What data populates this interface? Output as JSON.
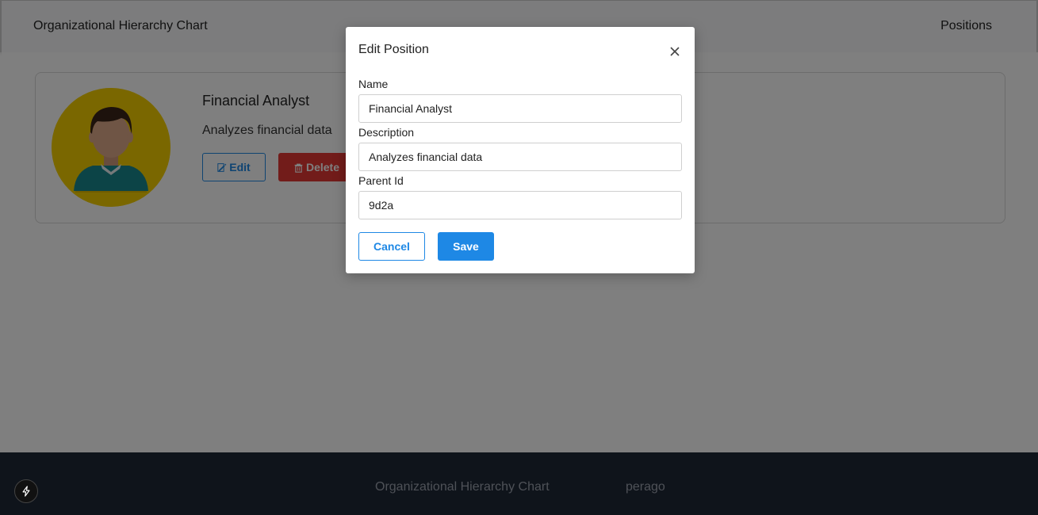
{
  "navbar": {
    "title": "Organizational Hierarchy Chart",
    "link": "Positions"
  },
  "card": {
    "title": "Financial Analyst",
    "description": "Analyzes financial data",
    "edit_label": "Edit",
    "delete_label": "Delete",
    "avatar_bg": "#f5cf00"
  },
  "modal": {
    "title": "Edit Position",
    "fields": [
      {
        "label": "Name",
        "value": "Financial Analyst"
      },
      {
        "label": "Description",
        "value": "Analyzes financial data"
      },
      {
        "label": "Parent Id",
        "value": "9d2a"
      }
    ],
    "cancel_label": "Cancel",
    "save_label": "Save"
  },
  "footer": {
    "title": "Organizational Hierarchy Chart",
    "brand": "perago"
  },
  "colors": {
    "accent": "#1e88e5",
    "danger": "#e53935",
    "footer_bg": "#1f2937"
  },
  "icons": {
    "close": "close-icon",
    "edit": "edit-icon",
    "delete": "trash-icon",
    "dev_indicator": "lightning-icon"
  }
}
